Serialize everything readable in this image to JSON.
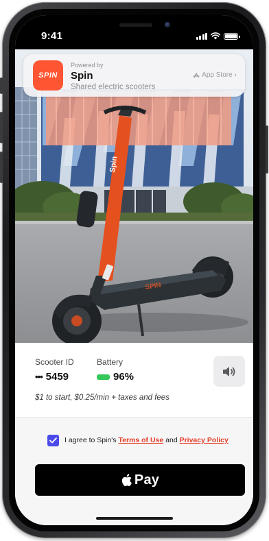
{
  "status_bar": {
    "time": "9:41"
  },
  "app_clip": {
    "logo_text": "SPIN",
    "powered_by": "Powered by",
    "app_name": "Spin",
    "subtitle": "Shared electric scooters",
    "store_label": "App Store",
    "store_chevron": "›",
    "icons": {
      "store": "app-store-icon",
      "chevron": "chevron-right-icon"
    }
  },
  "hero": {
    "scooter_deck_text": "SPIN",
    "stem_text": "Spin"
  },
  "scooter": {
    "id_label": "Scooter ID",
    "id_prefix": "•••",
    "id_value": "5459",
    "battery_label": "Battery",
    "battery_value": "96%",
    "battery_level": 0.96,
    "pricing": "$1 to start, $0.25/min + taxes and fees"
  },
  "agreement": {
    "checked": true,
    "prefix": "I agree to Spin's ",
    "terms_link": "Terms of Use",
    "joiner": " and ",
    "privacy_link": "Privacy Policy"
  },
  "pay_button": {
    "label": "Pay"
  },
  "colors": {
    "brand": "#ff5533",
    "checkbox": "#4b4ae8",
    "battery": "#34c759",
    "link": "#e5402a"
  }
}
